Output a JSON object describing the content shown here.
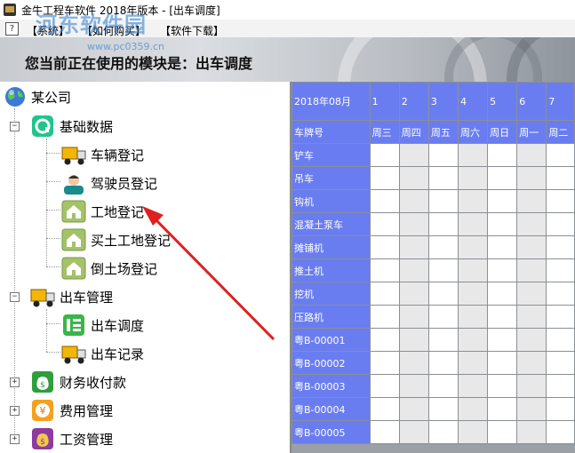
{
  "window": {
    "title": "金牛工程车软件 2018年版本 - [出车调度]"
  },
  "menu": {
    "items": [
      "【系统】",
      "【如何购买】",
      "【软件下载】"
    ]
  },
  "banner": {
    "text": "您当前正在使用的模块是：出车调度"
  },
  "watermark": {
    "text": "河东软件园",
    "url": "www.pc0359.cn"
  },
  "tree": {
    "root": "某公司",
    "groups": [
      {
        "label": "基础数据",
        "expanded": true,
        "icon": "data-circle-icon",
        "children": [
          {
            "label": "车辆登记",
            "icon": "truck-icon"
          },
          {
            "label": "驾驶员登记",
            "icon": "driver-icon"
          },
          {
            "label": "工地登记",
            "icon": "house-icon"
          },
          {
            "label": "买土工地登记",
            "icon": "house-icon"
          },
          {
            "label": "倒土场登记",
            "icon": "house-icon"
          }
        ]
      },
      {
        "label": "出车管理",
        "expanded": true,
        "icon": "truck-icon",
        "children": [
          {
            "label": "出车调度",
            "icon": "schedule-icon"
          },
          {
            "label": "出车记录",
            "icon": "truck-icon"
          }
        ]
      },
      {
        "label": "财务收付款",
        "expanded": false,
        "icon": "money-bag-icon",
        "children": []
      },
      {
        "label": "费用管理",
        "expanded": false,
        "icon": "yen-icon",
        "children": []
      },
      {
        "label": "工资管理",
        "expanded": false,
        "icon": "salary-bag-icon",
        "children": []
      }
    ]
  },
  "schedule": {
    "month_label": "2018年08月",
    "plate_header": "车牌号",
    "days": [
      "1",
      "2",
      "3",
      "4",
      "5",
      "6",
      "7"
    ],
    "weekdays": [
      "周三",
      "周四",
      "周五",
      "周六",
      "周日",
      "周一",
      "周二"
    ],
    "rows": [
      "铲车",
      "吊车",
      "钩机",
      "混凝土泵车",
      "摊铺机",
      "推土机",
      "挖机",
      "压路机",
      "粤B-00001",
      "粤B-00002",
      "粤B-00003",
      "粤B-00004",
      "粤B-00005"
    ]
  },
  "colors": {
    "header_blue": "#6a7df0",
    "annotation_arrow": "#e02020"
  }
}
